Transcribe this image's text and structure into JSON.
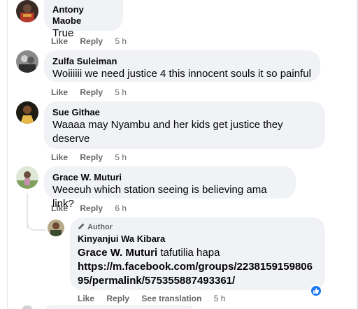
{
  "comments": [
    {
      "name": "Antony Maobe",
      "text": "True",
      "like": "Like",
      "reply": "Reply",
      "time": "5 h"
    },
    {
      "name": "Zulfa Suleiman",
      "text": "Woiiiiii we need justice 4 this innocent souls it so painful",
      "like": "Like",
      "reply": "Reply",
      "time": "5 h"
    },
    {
      "name": "Sue Githae",
      "text": "Waaaa may Nyambu and her kids get justice they deserve",
      "like": "Like",
      "reply": "Reply",
      "time": "5 h"
    },
    {
      "name": "Grace W. Muturi",
      "text": "Weeeuh which station seeing is believing ama link?",
      "like": "Like",
      "reply": "Reply",
      "time": "6 h"
    }
  ],
  "reply": {
    "badge": "Author",
    "name": "Kinyanjui Wa Kibara",
    "mention": "Grace W. Muturi",
    "text": "tafutilia hapa",
    "link": "https://m.facebook.com/groups/223815915980695/permalink/575355887493361/",
    "like": "Like",
    "reply": "Reply",
    "see_translation": "See translation",
    "time": "5 h",
    "reaction_icon": "thumbs-up-icon"
  },
  "colors": {
    "bubble": "#f0f2f5",
    "secondary_text": "#65676b",
    "like_blue": "#1877f2"
  }
}
